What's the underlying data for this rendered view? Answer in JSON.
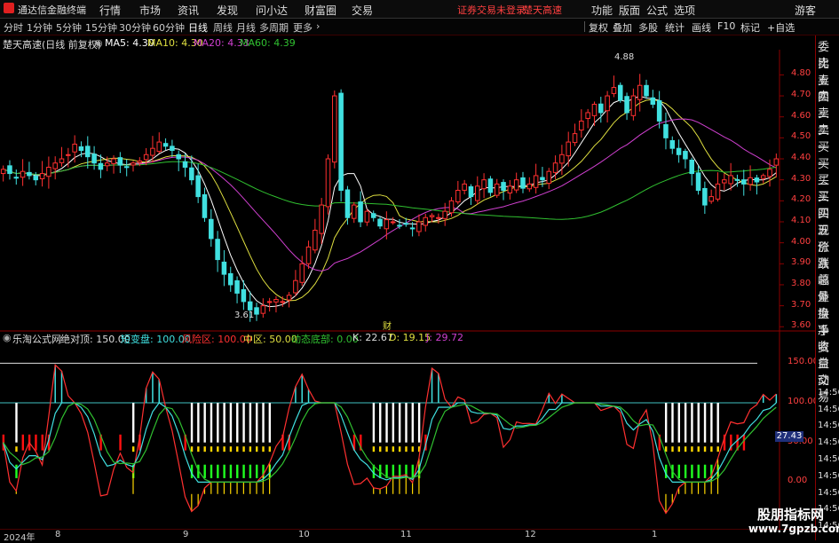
{
  "menubar": {
    "app_title": "通达信金融终端",
    "items": [
      "行情",
      "市场",
      "资讯",
      "发现",
      "问小达",
      "财富圈",
      "交易"
    ],
    "login_notice": "证券交易未登录",
    "stock_name": "楚天高速",
    "right_items": [
      "功能",
      "版面",
      "公式",
      "选项"
    ],
    "user": "游客"
  },
  "toolbar": {
    "periods": [
      "分时",
      "1分钟",
      "5分钟",
      "15分钟",
      "30分钟",
      "60分钟",
      "日线",
      "周线",
      "月线",
      "多周期",
      "更多"
    ],
    "active_period": "日线",
    "right_buttons": [
      "复权",
      "叠加",
      "多股",
      "统计",
      "画线",
      "F10",
      "标记",
      "+自选"
    ]
  },
  "info": {
    "title": "楚天高速(日线 前复权)",
    "ma5": "MA5: 4.30",
    "ma10": "MA10: 4.30",
    "ma20": "MA20: 4.33",
    "ma60": "MA60: 4.39",
    "high_label": "4.88",
    "low_label": "3.61",
    "fin_marker": "财"
  },
  "price_axis": [
    "4.80",
    "4.70",
    "4.60",
    "4.50",
    "4.40",
    "4.30",
    "4.20",
    "4.10",
    "4.00",
    "3.90",
    "3.80",
    "3.70",
    "3.60"
  ],
  "indicator": {
    "name": "乐淘公式网",
    "fields": [
      "绝对顶: 150.00",
      "短变盘: 100.00",
      "风险区: 100.00",
      "中区: 50.00",
      "动态底部: 0.00",
      "K: 22.67",
      "D: 19.15",
      "J: 29.72"
    ],
    "axis": [
      "150.00",
      "100.00",
      "50.00",
      "0.00"
    ],
    "current_value": "27.43"
  },
  "dates": [
    "2024年",
    "8",
    "9",
    "10",
    "11",
    "12",
    "1"
  ],
  "right_panel": [
    "委比",
    "卖五",
    "卖四",
    "卖三",
    "卖二",
    "卖一",
    "买一",
    "买二",
    "买三",
    "买四",
    "买五",
    "现价",
    "涨跌",
    "涨幅",
    "总量",
    "外盘",
    "换手",
    "净资",
    "收益",
    "自动",
    "交易",
    "14:56",
    "14:56",
    "14:56",
    "14:56",
    "14:56",
    "14:56",
    "14:56",
    "14:56",
    "14:56"
  ],
  "watermark": {
    "line1": "股朋指标网",
    "line2": "www.7gpzb.com"
  },
  "colors": {
    "up": "#ff3030",
    "down": "#40e0e0",
    "ma5": "#ffffff",
    "ma10": "#e0e040",
    "ma20": "#d040d0",
    "ma60": "#30c030",
    "danger_bar": "#ff1010",
    "top_bar": "#ffffff",
    "yellow_bar": "#ffd700",
    "green_bar": "#20ff20"
  },
  "chart_data": {
    "type": "candlestick",
    "y_range": [
      3.58,
      4.92
    ],
    "closes": [
      4.35,
      4.33,
      4.31,
      4.34,
      4.32,
      4.3,
      4.33,
      4.36,
      4.38,
      4.4,
      4.42,
      4.47,
      4.44,
      4.41,
      4.38,
      4.35,
      4.38,
      4.4,
      4.37,
      4.36,
      4.38,
      4.39,
      4.42,
      4.45,
      4.48,
      4.46,
      4.44,
      4.4,
      4.36,
      4.3,
      4.22,
      4.12,
      4.02,
      3.92,
      3.85,
      3.8,
      3.76,
      3.72,
      3.68,
      3.66,
      3.7,
      3.72,
      3.73,
      3.72,
      3.75,
      3.82,
      3.9,
      3.98,
      4.06,
      4.18,
      4.4,
      4.7,
      4.25,
      4.12,
      4.18,
      4.1,
      4.15,
      4.12,
      4.08,
      4.11,
      4.1,
      4.08,
      4.09,
      4.07,
      4.1,
      4.12,
      4.13,
      4.12,
      4.15,
      4.2,
      4.25,
      4.28,
      4.22,
      4.27,
      4.3,
      4.24,
      4.28,
      4.25,
      4.27,
      4.3,
      4.26,
      4.28,
      4.32,
      4.3,
      4.34,
      4.38,
      4.42,
      4.48,
      4.52,
      4.58,
      4.62,
      4.66,
      4.62,
      4.7,
      4.74,
      4.68,
      4.62,
      4.7,
      4.75,
      4.7,
      4.66,
      4.58,
      4.5,
      4.45,
      4.42,
      4.4,
      4.33,
      4.25,
      4.18,
      4.22,
      4.28,
      4.3,
      4.32,
      4.3,
      4.28,
      4.31,
      4.29,
      4.32,
      4.35,
      4.4
    ]
  }
}
